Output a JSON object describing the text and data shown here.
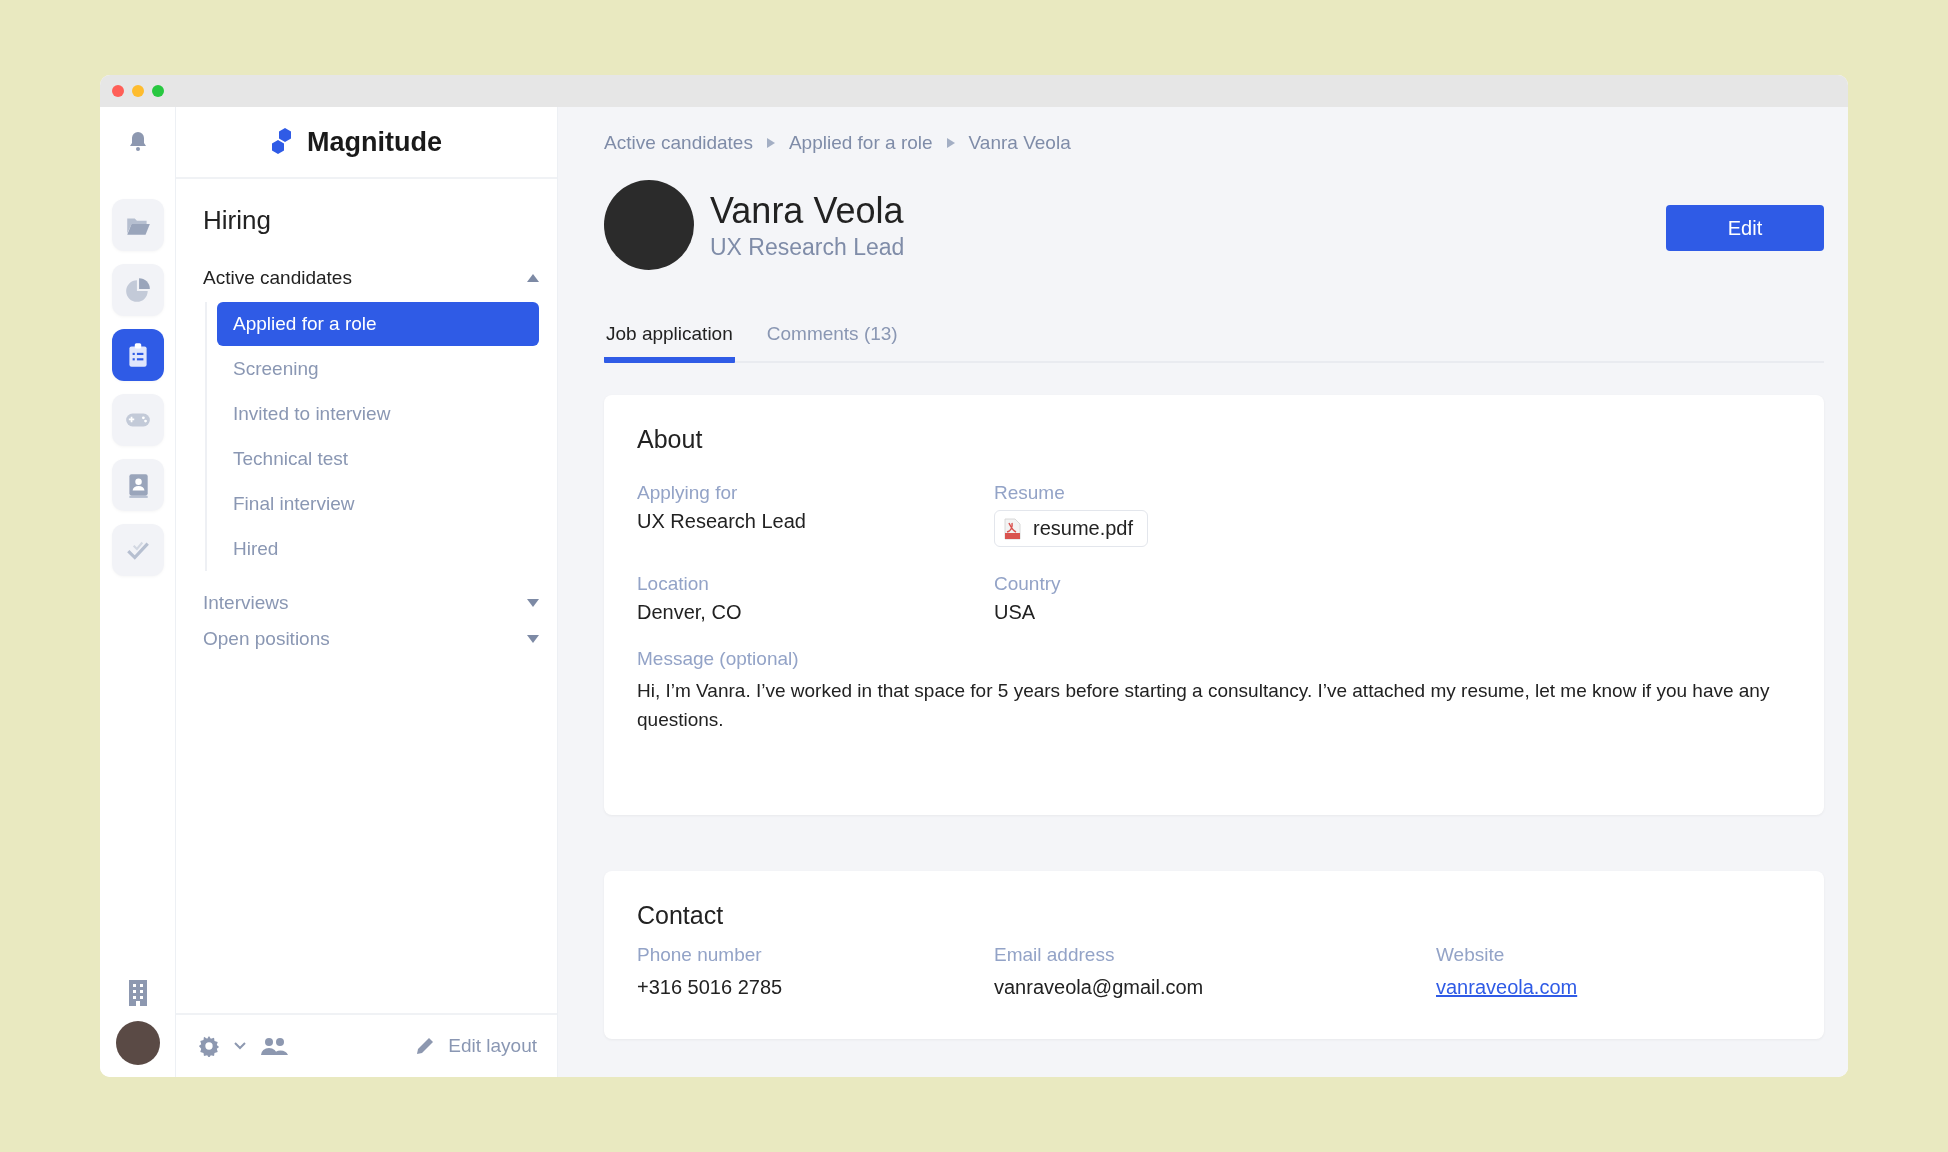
{
  "rail": {
    "items": [
      {
        "selected": false
      },
      {
        "selected": false
      },
      {
        "selected": true
      },
      {
        "selected": false
      },
      {
        "selected": false
      },
      {
        "selected": false
      }
    ]
  },
  "sidebar": {
    "brand": "Magnitude",
    "title": "Hiring",
    "groups": [
      {
        "label": "Active candidates",
        "expanded": true,
        "children": [
          {
            "label": "Applied for a role",
            "selected": true
          },
          {
            "label": "Screening",
            "selected": false
          },
          {
            "label": "Invited to interview",
            "selected": false
          },
          {
            "label": "Technical test",
            "selected": false
          },
          {
            "label": "Final interview",
            "selected": false
          },
          {
            "label": "Hired",
            "selected": false
          }
        ]
      },
      {
        "label": "Interviews",
        "expanded": false
      },
      {
        "label": "Open positions",
        "expanded": false
      }
    ],
    "footer": {
      "edit_layout": "Edit layout"
    }
  },
  "main": {
    "breadcrumb": [
      "Active candidates",
      "Applied for a role",
      "Vanra Veola"
    ],
    "profile": {
      "name": "Vanra Veola",
      "role": "UX Research Lead"
    },
    "edit_button": "Edit",
    "tabs": [
      {
        "label": "Job application",
        "selected": true
      },
      {
        "label": "Comments (13)",
        "selected": false
      }
    ],
    "about": {
      "title": "About",
      "fields": [
        {
          "label": "Applying for",
          "value": "UX Research Lead",
          "kind": "text"
        },
        {
          "label": "Resume",
          "value": "resume.pdf",
          "kind": "file"
        },
        {
          "label": "Location",
          "value": "Denver, CO",
          "kind": "text"
        },
        {
          "label": "Country",
          "value": "USA",
          "kind": "text"
        }
      ],
      "message": {
        "label": "Message (optional)",
        "value": "Hi, I’m Vanra. I’ve worked in that space for 5 years before starting a consultancy. I’ve attached my resume, let me know if you have any questions."
      }
    },
    "contact": {
      "title": "Contact",
      "fields": [
        {
          "label": "Phone number",
          "value": "+316 5016 2785",
          "kind": "text"
        },
        {
          "label": "Email address",
          "value": "vanraveola@gmail.com",
          "kind": "text"
        },
        {
          "label": "Website",
          "value": "vanraveola.com",
          "kind": "link"
        }
      ]
    }
  }
}
